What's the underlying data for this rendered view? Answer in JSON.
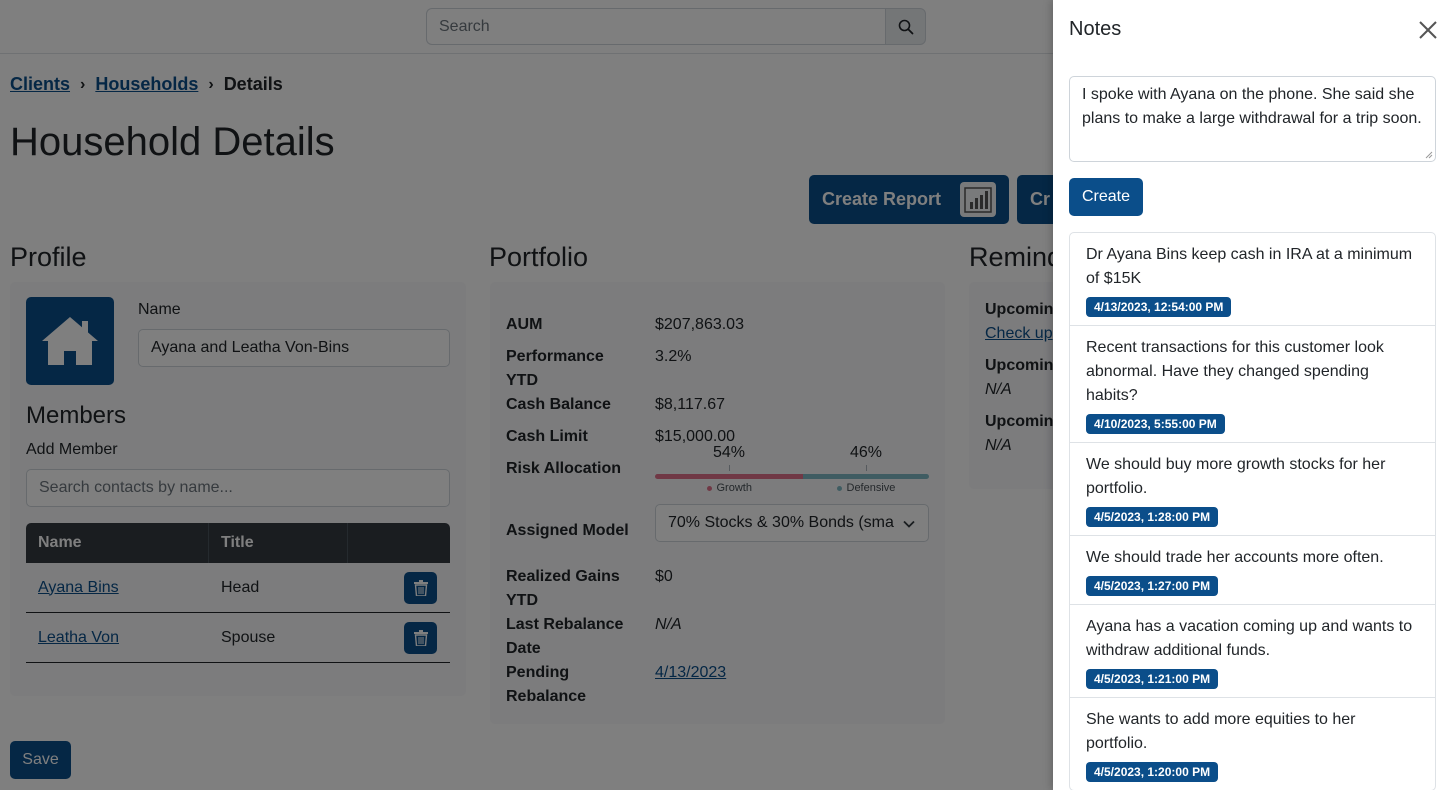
{
  "search": {
    "placeholder": "Search"
  },
  "breadcrumb": {
    "clients": "Clients",
    "households": "Households",
    "current": "Details",
    "sep": "›"
  },
  "page": {
    "title": "Household Details"
  },
  "actions": {
    "create_report": "Create Report",
    "create_other": "Cr"
  },
  "profile": {
    "section_title": "Profile",
    "name_label": "Name",
    "name_value": "Ayana and Leatha Von-Bins",
    "members_title": "Members",
    "add_member_label": "Add Member",
    "add_member_placeholder": "Search contacts by name...",
    "table_headers": {
      "name": "Name",
      "title": "Title"
    },
    "members": [
      {
        "name": "Ayana Bins",
        "title": "Head"
      },
      {
        "name": "Leatha Von",
        "title": "Spouse"
      }
    ]
  },
  "portfolio": {
    "section_title": "Portfolio",
    "aum_label": "AUM",
    "aum": "$207,863.03",
    "perf_label_1": "Performance",
    "perf_label_2": "YTD",
    "perf": "3.2%",
    "cash_balance_label": "Cash Balance",
    "cash_balance": "$8,117.67",
    "cash_limit_label": "Cash Limit",
    "cash_limit": "$15,000.00",
    "risk_label": "Risk Allocation",
    "risk": {
      "growth_pct": "54%",
      "defensive_pct": "46%",
      "growth_fraction": 0.54,
      "growth_label": "Growth",
      "defensive_label": "Defensive",
      "growth_color": "#e0718b",
      "defensive_color": "#7fb8c4"
    },
    "model_label": "Assigned Model",
    "model_value": "70% Stocks & 30% Bonds (sma",
    "gains_label_1": "Realized Gains",
    "gains_label_2": "YTD",
    "gains": "$0",
    "rebalance_label_1": "Last Rebalance",
    "rebalance_label_2": "Date",
    "rebalance": "N/A",
    "pending_label_1": "Pending",
    "pending_label_2": "Rebalance",
    "pending": "4/13/2023"
  },
  "reminders": {
    "section_title": "Remind",
    "upcoming_1": "Upcomin",
    "link_1": "Check up",
    "upcoming_2": "Upcomin",
    "value_2": "N/A",
    "upcoming_3": "Upcomin",
    "value_3": "N/A"
  },
  "save_label": "Save",
  "notes": {
    "title": "Notes",
    "draft": "I spoke with Ayana on the phone. She said she plans to make a large withdrawal for a trip soon.",
    "create_label": "Create",
    "items": [
      {
        "text": "Dr Ayana Bins keep cash in IRA at a minimum of $15K",
        "date": "4/13/2023, 12:54:00 PM"
      },
      {
        "text": "Recent transactions for this customer look abnormal. Have they changed spending habits?",
        "date": "4/10/2023, 5:55:00 PM"
      },
      {
        "text": "We should buy more growth stocks for her portfolio.",
        "date": "4/5/2023, 1:28:00 PM"
      },
      {
        "text": "We should trade her accounts more often.",
        "date": "4/5/2023, 1:27:00 PM"
      },
      {
        "text": "Ayana has a vacation coming up and wants to withdraw additional funds.",
        "date": "4/5/2023, 1:21:00 PM"
      },
      {
        "text": "She wants to add more equities to her portfolio.",
        "date": "4/5/2023, 1:20:00 PM"
      }
    ]
  },
  "colors": {
    "primary": "#0b4e8a",
    "dark_header": "#343a40"
  }
}
